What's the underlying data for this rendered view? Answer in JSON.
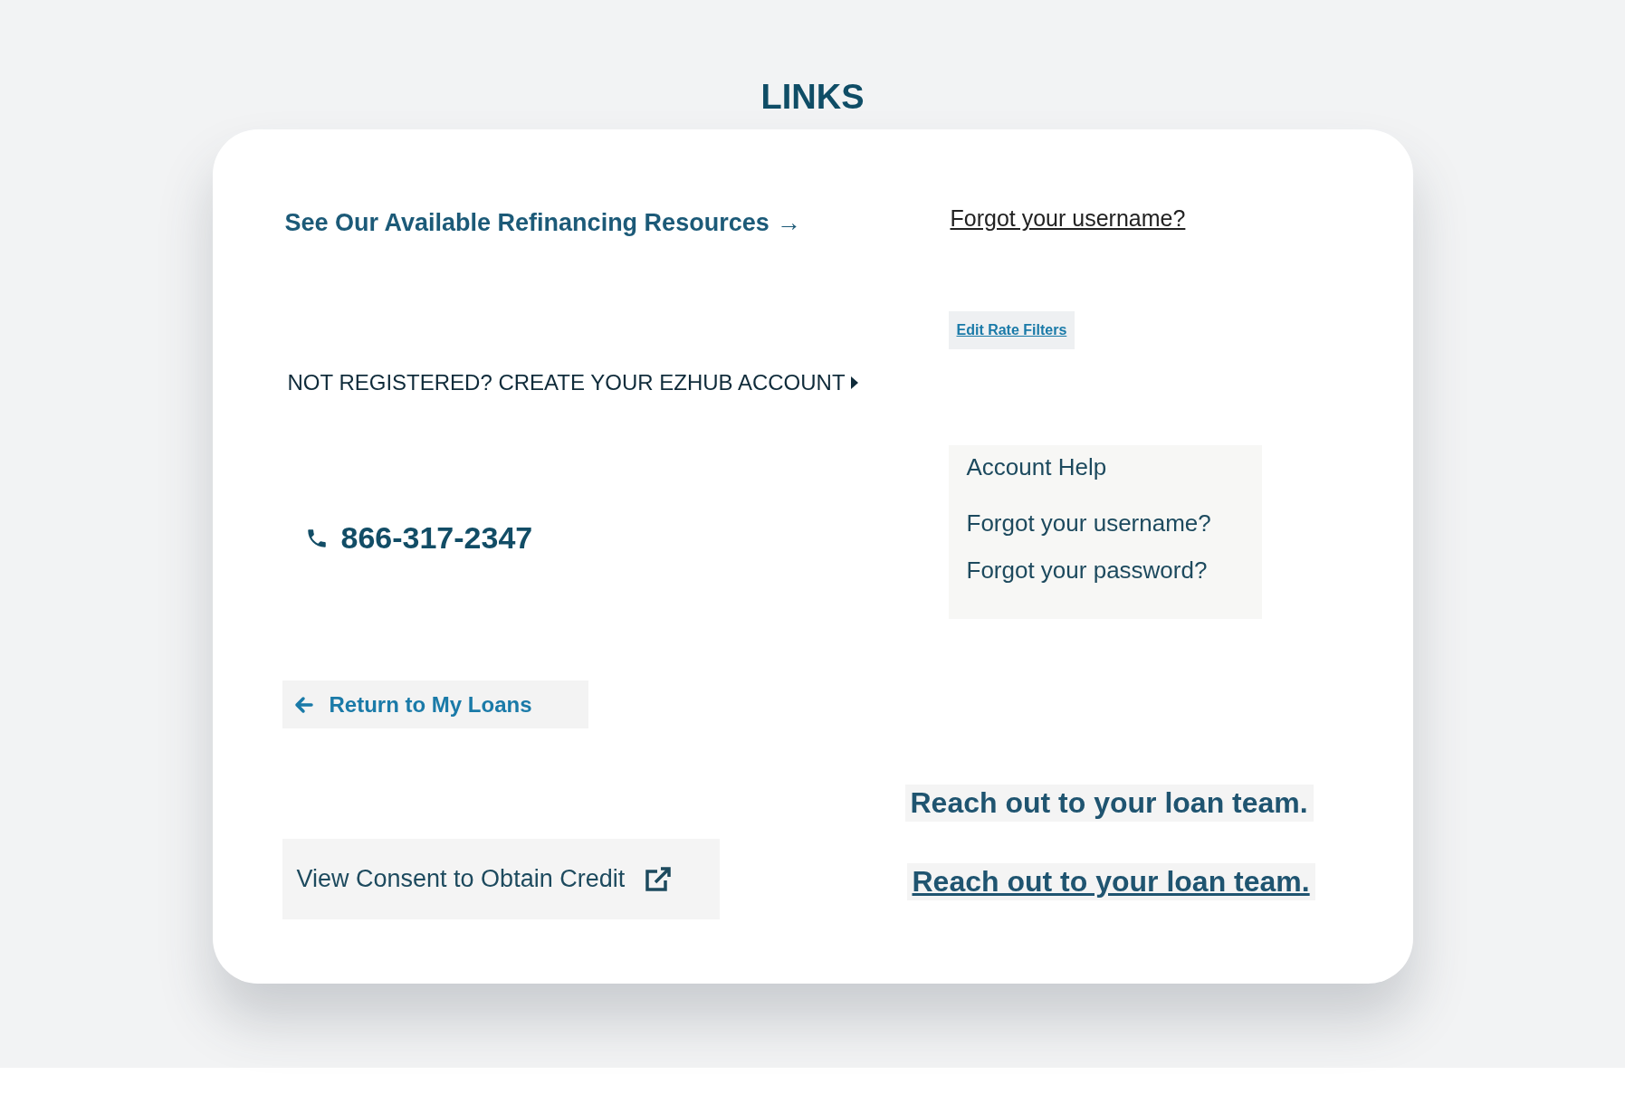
{
  "page": {
    "title": "LINKS"
  },
  "left": [
    {
      "kind": "arrow_link",
      "text": "See Our Available Refinancing Resources",
      "arrow": "→"
    },
    {
      "kind": "caret_link",
      "text": "NOT REGISTERED? CREATE YOUR EZHUB ACCOUNT"
    },
    {
      "kind": "phone",
      "text": "866-317-2347"
    },
    {
      "kind": "back_button",
      "text": "Return to My Loans"
    },
    {
      "kind": "external_button",
      "text": "View Consent to Obtain Credit"
    }
  ],
  "right": [
    {
      "kind": "plain_link",
      "text": "Forgot your username?"
    },
    {
      "kind": "small_button",
      "text": "Edit Rate Filters"
    },
    {
      "kind": "help_menu",
      "heading": "Account Help",
      "items": [
        "Forgot your username?",
        "Forgot your password?"
      ]
    },
    {
      "kind": "bold_text",
      "text": "Reach out to your loan team."
    },
    {
      "kind": "bold_link",
      "text": "Reach out to your loan team."
    }
  ]
}
